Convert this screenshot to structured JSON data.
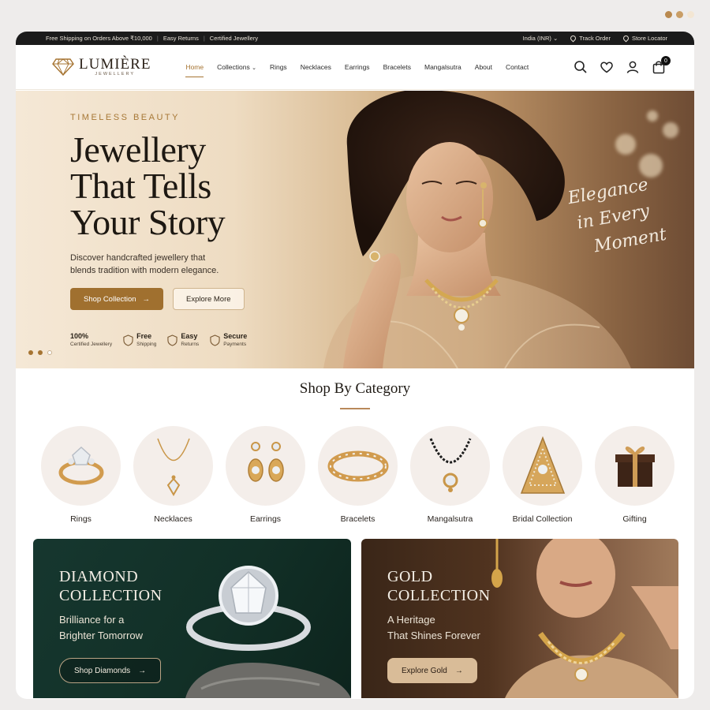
{
  "topbar": {
    "left": [
      "Free Shipping on Orders Above ₹10,000",
      "Easy Returns",
      "Certified Jewellery"
    ],
    "region": "India (INR)",
    "track_order": "Track Order",
    "store_locator": "Store Locator"
  },
  "logo": {
    "brand": "LUMIÈRE",
    "sub": "JEWELLERY"
  },
  "nav": {
    "items": [
      "Home",
      "Collections",
      "Rings",
      "Necklaces",
      "Earrings",
      "Bracelets",
      "Mangalsutra",
      "About",
      "Contact"
    ],
    "active": "Home",
    "cart_count": "0",
    "icons": [
      "search-icon",
      "heart-icon",
      "user-icon",
      "bag-icon"
    ]
  },
  "hero": {
    "eyebrow": "TIMELESS BEAUTY",
    "title_lines": [
      "Jewellery",
      "That Tells",
      "Your Story"
    ],
    "description": "Discover handcrafted jewellery that blends tradition with modern elegance.",
    "primary_cta": "Shop Collection",
    "secondary_cta": "Explore More",
    "features": [
      {
        "t1": "100%",
        "t2": "Certified Jewellery"
      },
      {
        "t1": "Free",
        "t2": "Shipping"
      },
      {
        "t1": "Easy",
        "t2": "Returns"
      },
      {
        "t1": "Secure",
        "t2": "Payments"
      }
    ],
    "script_lines": [
      "Elegance",
      "in Every",
      "Moment"
    ],
    "slide_index": 2,
    "slide_count": 3
  },
  "categories": {
    "title": "Shop By Category",
    "items": [
      "Rings",
      "Necklaces",
      "Earrings",
      "Bracelets",
      "Mangalsutra",
      "Bridal Collection",
      "Gifting"
    ]
  },
  "promos": {
    "diamond": {
      "title_lines": [
        "DIAMOND",
        "COLLECTION"
      ],
      "sub_lines": [
        "Brilliance for a",
        "Brighter Tomorrow"
      ],
      "cta": "Shop Diamonds"
    },
    "gold": {
      "title_lines": [
        "GOLD",
        "COLLECTION"
      ],
      "sub_lines": [
        "A Heritage",
        "That Shines Forever"
      ],
      "cta": "Explore Gold"
    }
  },
  "colors": {
    "accent": "#a0702f",
    "dark": "#1b1b1b",
    "diamond_bg": "#16372f",
    "gold_bg": "#50331f"
  }
}
